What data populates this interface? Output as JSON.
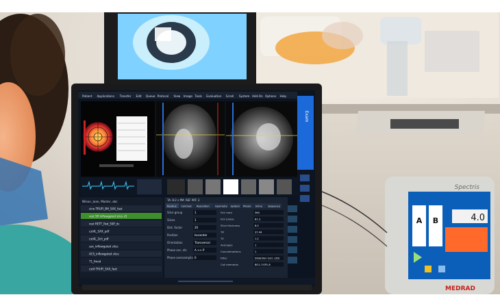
{
  "menu": {
    "items": [
      "Patient",
      "Applications",
      "Transfer",
      "Edit",
      "Queue",
      "Protocol",
      "View",
      "Image",
      "Tools",
      "Evaluation",
      "Scroll",
      "System",
      "Add-On",
      "Options",
      "Help"
    ]
  },
  "side_tab": {
    "label": "Exam"
  },
  "queue": {
    "patient_name": "Nilson, Joan, Master, abc",
    "rows": [
      "cine TRUFI_BH_SAX_fast",
      "rest SR Inflowgated slice x5",
      "rest RETT_Pad_SSP_dc",
      "cst4L_SAX_pdf",
      "cst4L_2ch_pdf",
      "sax_inflowgated slice",
      "ACS_inflowgated slice",
      "T1_fmod",
      "cst4 TRUFI_SAX_fast"
    ]
  },
  "params": {
    "heading": "TA: 8:2 s  PM: REF  PAT: 2",
    "tabs": [
      "Routine",
      "Contrast",
      "Resolution",
      "Geometry",
      "System",
      "Physio",
      "Inline",
      "Sequence"
    ],
    "left": [
      {
        "label": "Slice group",
        "value": "1"
      },
      {
        "label": "Slices",
        "value": "1"
      },
      {
        "label": "Dist. factor",
        "value": "20"
      },
      {
        "label": "Position",
        "value": "Isocenter"
      },
      {
        "label": "Orientation",
        "value": "Transversal"
      },
      {
        "label": "Phase enc. dir.",
        "value": "A >> P"
      },
      {
        "label": "Phase oversampling",
        "value": "0"
      }
    ],
    "right": [
      {
        "label": "FoV read",
        "value": "360"
      },
      {
        "label": "FoV phase",
        "value": "81.3"
      },
      {
        "label": "Slice thickness",
        "value": "8.0"
      },
      {
        "label": "TR",
        "value": "37.44"
      },
      {
        "label": "TE",
        "value": "1.2"
      },
      {
        "label": "Averages",
        "value": "1"
      },
      {
        "label": "Concatenations",
        "value": "1"
      },
      {
        "label": "Filter",
        "value": "Distortion Corr. (2D)"
      },
      {
        "label": "Coil elements",
        "value": "BO1-7;SP1-8"
      }
    ]
  },
  "injector": {
    "brand": "MEDRAD",
    "logo": "Spectris",
    "value": "4.0",
    "labels": [
      "A",
      "B"
    ]
  },
  "colors": {
    "screen_bg": "#0b1420",
    "accent_blue": "#1c6ad9",
    "queue_highlight": "#3f8f2c",
    "injector_panel": "#ff6a2a"
  }
}
